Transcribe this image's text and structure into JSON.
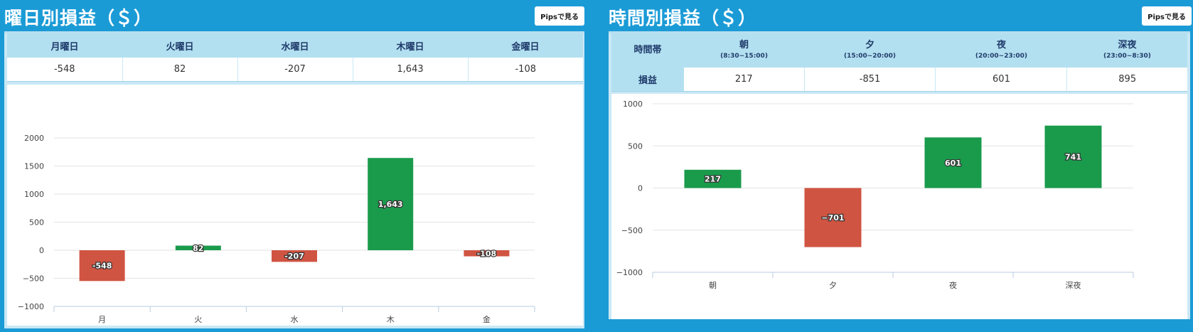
{
  "left_panel": {
    "title": "曜日別損益（＄）",
    "pips_button": "Pipsで見る",
    "table": {
      "headers": [
        "月曜日",
        "火曜日",
        "水曜日",
        "木曜日",
        "金曜日"
      ],
      "values": [
        "-548",
        "82",
        "-207",
        "1,643",
        "-108"
      ]
    }
  },
  "right_panel": {
    "title": "時間別損益（＄）",
    "pips_button": "Pipsで見る",
    "table": {
      "row_header_top": "時間帯",
      "row_header_bottom": "損益",
      "columns": [
        {
          "label": "朝",
          "range": "(8:30~15:00)",
          "value": "217"
        },
        {
          "label": "夕",
          "range": "(15:00~20:00)",
          "value": "-851"
        },
        {
          "label": "夜",
          "range": "(20:00~23:00)",
          "value": "601"
        },
        {
          "label": "深夜",
          "range": "(23:00~8:30)",
          "value": "895"
        }
      ]
    }
  },
  "colors": {
    "positive": "#1a9b4c",
    "negative": "#d05442",
    "background": "#1b9bd6"
  },
  "chart_data": [
    {
      "type": "bar",
      "categories": [
        "月",
        "火",
        "水",
        "木",
        "金"
      ],
      "values": [
        -548,
        82,
        -207,
        1643,
        -108
      ],
      "data_labels": [
        "-548",
        "82",
        "-207",
        "1,643",
        "-108"
      ],
      "ylim": [
        -1000,
        2000
      ],
      "yticks": [
        -1000,
        -500,
        0,
        500,
        1000,
        1500,
        2000
      ],
      "ytick_labels": [
        "−1000",
        "−500",
        "0",
        "500",
        "1000",
        "1500",
        "2000"
      ],
      "grid": true
    },
    {
      "type": "bar",
      "categories": [
        "朝",
        "夕",
        "夜",
        "深夜"
      ],
      "values": [
        217,
        -701,
        601,
        741
      ],
      "data_labels": [
        "217",
        "−701",
        "601",
        "741"
      ],
      "ylim": [
        -1000,
        1000
      ],
      "yticks": [
        -1000,
        -500,
        0,
        500,
        1000
      ],
      "ytick_labels": [
        "−1000",
        "−500",
        "0",
        "500",
        "1000"
      ],
      "grid": true
    }
  ]
}
